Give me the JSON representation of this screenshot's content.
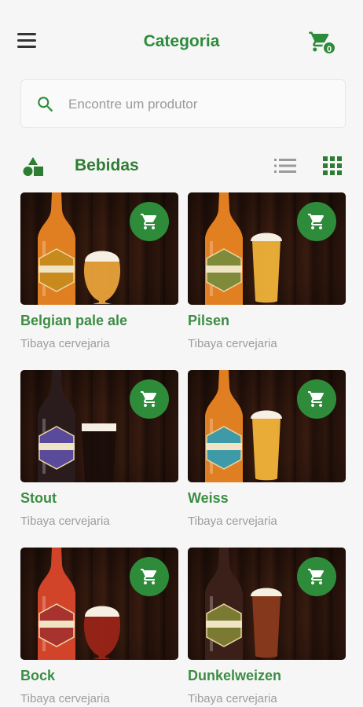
{
  "header": {
    "title": "Categoria",
    "cart_count": "0"
  },
  "search": {
    "placeholder": "Encontre um produtor"
  },
  "category": {
    "title": "Bebidas"
  },
  "products": [
    {
      "name": "Belgian pale ale",
      "brand": "Tibaya cervejaria",
      "bottle_color": "#e07f22",
      "label_color": "#c88a1c",
      "liquid_color": "#e8a23a",
      "foam": true,
      "glass": "tulip"
    },
    {
      "name": "Pilsen",
      "brand": "Tibaya cervejaria",
      "bottle_color": "#e27f21",
      "label_color": "#7f8a3a",
      "liquid_color": "#f0b23a",
      "foam": true,
      "glass": "tall"
    },
    {
      "name": "Stout",
      "brand": "Tibaya cervejaria",
      "bottle_color": "#2a1c1c",
      "label_color": "#5a4a9a",
      "liquid_color": "#1a0e0a",
      "foam": true,
      "glass": "pint"
    },
    {
      "name": "Weiss",
      "brand": "Tibaya cervejaria",
      "bottle_color": "#e07f22",
      "label_color": "#3f9aa8",
      "liquid_color": "#f2b43a",
      "foam": true,
      "glass": "tall"
    },
    {
      "name": "Bock",
      "brand": "Tibaya cervejaria",
      "bottle_color": "#d2442a",
      "label_color": "#a8322e",
      "liquid_color": "#9a2418",
      "foam": true,
      "glass": "tulip"
    },
    {
      "name": "Dunkelweizen",
      "brand": "Tibaya cervejaria",
      "bottle_color": "#3a2018",
      "label_color": "#7a7a32",
      "liquid_color": "#8a3a1c",
      "foam": true,
      "glass": "tall"
    }
  ]
}
